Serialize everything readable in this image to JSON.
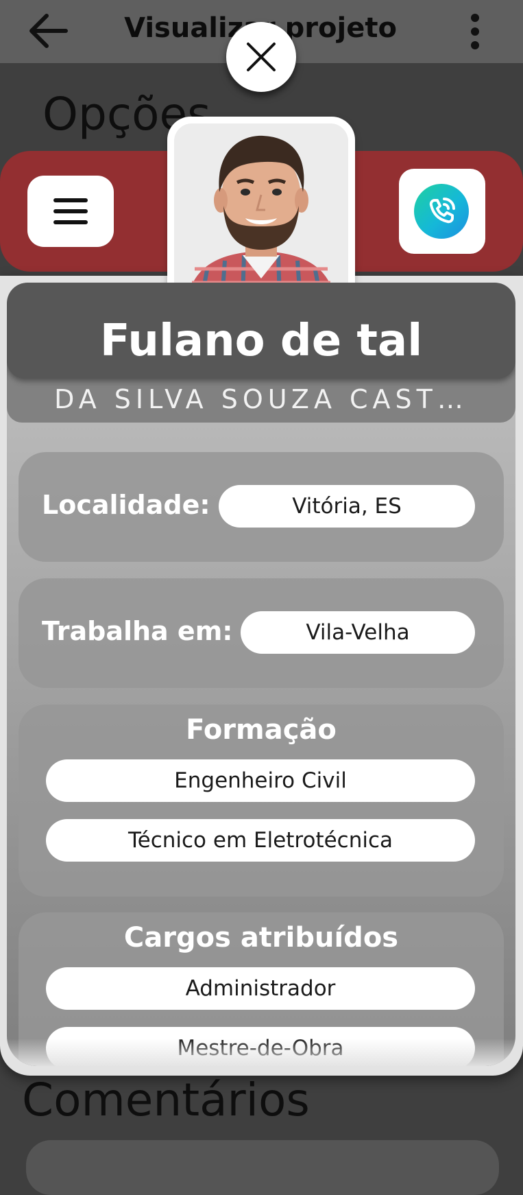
{
  "appbar": {
    "title": "Visualizar projeto",
    "back_icon": "arrow-left-icon",
    "more_icon": "more-vertical-icon"
  },
  "background": {
    "options_heading": "Opções",
    "comments_heading": "Comentários"
  },
  "modal": {
    "close_icon": "close-icon",
    "menu_icon": "hamburger-menu-icon",
    "call_icon": "phone-call-icon",
    "avatar_icon": "profile-photo",
    "name": "Fulano de tal",
    "surname": "DA SILVA SOUZA CAST…",
    "location": {
      "label": "Localidade:",
      "value": "Vitória, ES"
    },
    "workplace": {
      "label": "Trabalha em:",
      "value": "Vila-Velha"
    },
    "education": {
      "title": "Formação",
      "items": [
        "Engenheiro Civil",
        "Técnico em Eletrotécnica"
      ]
    },
    "roles": {
      "title": "Cargos atribuídos",
      "items": [
        "Administrador",
        "Mestre-de-Obra"
      ]
    }
  },
  "colors": {
    "band_red": "#932f31",
    "overlay": "#3f3f3f",
    "call_gradient": [
      "#1fd0a0",
      "#1c8fe0"
    ]
  }
}
